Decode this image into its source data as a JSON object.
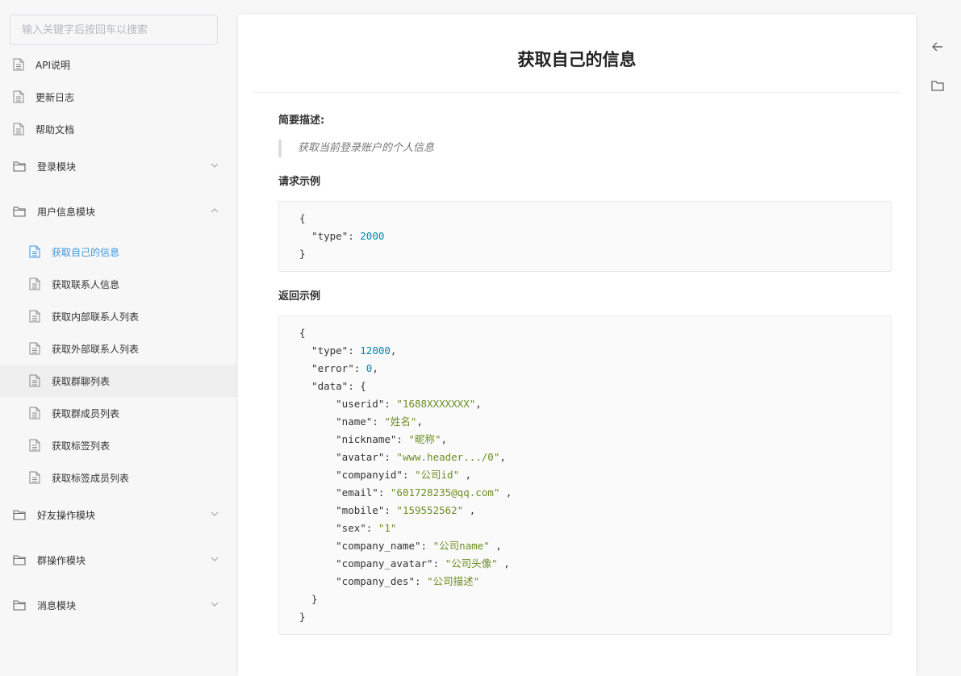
{
  "search": {
    "placeholder": "输入关键字后按回车以搜索"
  },
  "sidebar": {
    "top_items": [
      "API说明",
      "更新日志",
      "帮助文档"
    ],
    "folders": {
      "login": "登录模块",
      "user_info": "用户信息模块",
      "friend_ops": "好友操作模块",
      "group_ops": "群操作模块",
      "message": "消息模块"
    },
    "user_info_children": [
      "获取自己的信息",
      "获取联系人信息",
      "获取内部联系人列表",
      "获取外部联系人列表",
      "获取群聊列表",
      "获取群成员列表",
      "获取标签列表",
      "获取标签成员列表"
    ],
    "active_item": "获取自己的信息",
    "hover_item": "获取群聊列表"
  },
  "doc": {
    "title": "获取自己的信息",
    "summary_label": "简要描述:",
    "summary_text": "获取当前登录账户的个人信息",
    "request_label": "请求示例",
    "response_label": "返回示例"
  },
  "request_example": {
    "type": "2000"
  },
  "response_example": {
    "type": "12000",
    "error": "0",
    "data": {
      "userid": "1688XXXXXXX",
      "name": "姓名",
      "nickname": "昵称",
      "avatar": "www.header.../0",
      "companyid": "公司id",
      "email": "601728235@qq.com",
      "mobile": "159552562",
      "sex": "1",
      "company_name": "公司name",
      "company_avatar": "公司头像",
      "company_des": "公司描述"
    }
  },
  "icons": {
    "doc": "document-icon",
    "folder": "folder-icon",
    "chevron_down": "chevron-down-icon",
    "chevron_up": "chevron-up-icon",
    "back": "arrow-left-icon",
    "catalog": "folder-icon"
  },
  "colors": {
    "active": "#3d97e0",
    "hover_bg": "#efefef"
  }
}
